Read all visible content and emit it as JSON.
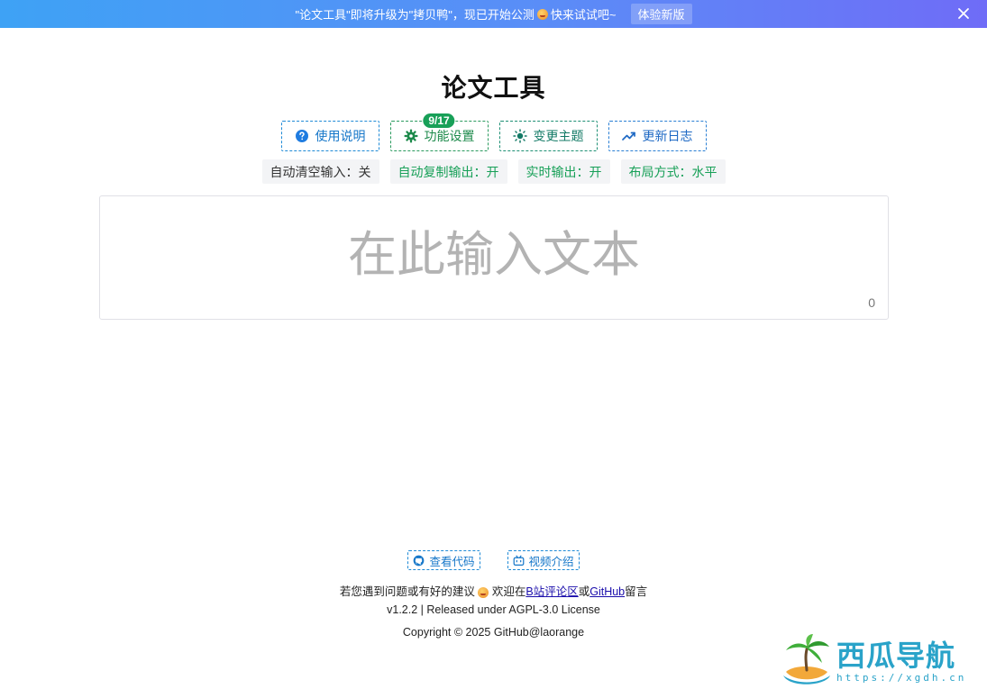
{
  "banner": {
    "text_before": "\"论文工具\"即将升级为\"拷贝鸭\"，现已开始公测",
    "text_after": "快来试试吧~",
    "cta_label": "体验新版"
  },
  "app": {
    "title": "论文工具"
  },
  "toolbar": {
    "help_label": "使用说明",
    "settings_label": "功能设置",
    "settings_badge": "9/17",
    "theme_label": "变更主题",
    "changelog_label": "更新日志"
  },
  "status": {
    "auto_clear": "自动清空输入：关",
    "auto_copy": "自动复制输出：开",
    "realtime": "实时输出：开",
    "layout": "布局方式：水平"
  },
  "editor": {
    "placeholder": "在此输入文本",
    "value": "",
    "count": "0"
  },
  "footer": {
    "code_label": "查看代码",
    "video_label": "视频介绍",
    "feedback_before": "若您遇到问题或有好的建议",
    "feedback_mid": "欢迎在",
    "bilibili_link": "B站评论区",
    "or": "或",
    "github_link": "GitHub",
    "feedback_after": "留言",
    "version": "v1.2.2 | Released under AGPL-3.0 License",
    "copyright": "Copyright © 2025 GitHub@laorange"
  },
  "watermark": {
    "name": "西瓜导航",
    "url": "https://xgdh.cn"
  },
  "colors": {
    "accent_blue": "#1677c9",
    "accent_green": "#18a058",
    "banner_start": "#3ea2f5",
    "banner_end": "#6f6cf7"
  }
}
